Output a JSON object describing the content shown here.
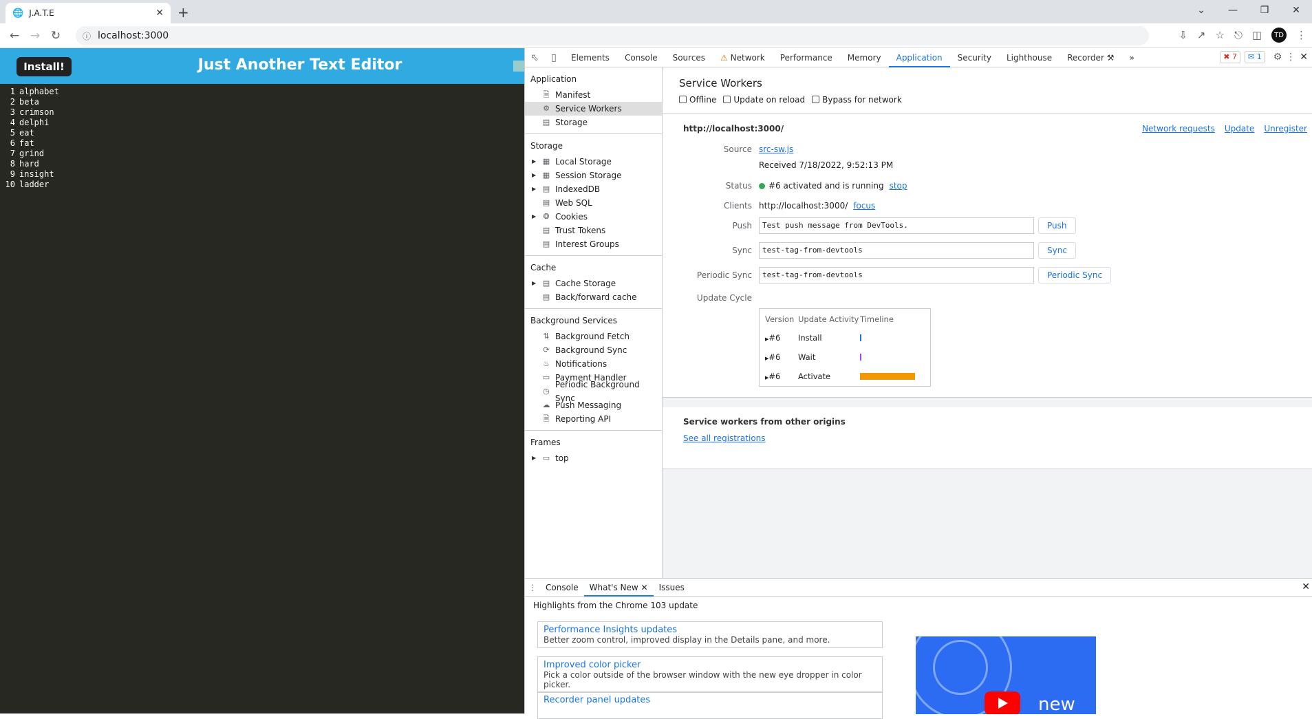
{
  "browser": {
    "tab_title": "J.A.T.E",
    "url": "localhost:3000",
    "avatar_initials": "TD"
  },
  "app": {
    "install_label": "Install!",
    "title": "Just Another Text Editor",
    "lines": [
      {
        "n": "1",
        "text": "alphabet"
      },
      {
        "n": "2",
        "text": "beta"
      },
      {
        "n": "3",
        "text": "crimson"
      },
      {
        "n": "4",
        "text": "delphi"
      },
      {
        "n": "5",
        "text": "eat"
      },
      {
        "n": "6",
        "text": "fat"
      },
      {
        "n": "7",
        "text": "grind"
      },
      {
        "n": "8",
        "text": "hard"
      },
      {
        "n": "9",
        "text": "insight"
      },
      {
        "n": "10",
        "text": "ladder"
      }
    ]
  },
  "devtools": {
    "tabs": [
      "Elements",
      "Console",
      "Sources",
      "Network",
      "Performance",
      "Memory",
      "Application",
      "Security",
      "Lighthouse",
      "Recorder"
    ],
    "active_tab": "Application",
    "error_count": "7",
    "message_count": "1",
    "sidebar": {
      "application": {
        "title": "Application",
        "items": [
          "Manifest",
          "Service Workers",
          "Storage"
        ]
      },
      "storage": {
        "title": "Storage",
        "items": [
          "Local Storage",
          "Session Storage",
          "IndexedDB",
          "Web SQL",
          "Cookies",
          "Trust Tokens",
          "Interest Groups"
        ]
      },
      "cache": {
        "title": "Cache",
        "items": [
          "Cache Storage",
          "Back/forward cache"
        ]
      },
      "background": {
        "title": "Background Services",
        "items": [
          "Background Fetch",
          "Background Sync",
          "Notifications",
          "Payment Handler",
          "Periodic Background Sync",
          "Push Messaging",
          "Reporting API"
        ]
      },
      "frames": {
        "title": "Frames",
        "items": [
          "top"
        ]
      }
    },
    "sw": {
      "title": "Service Workers",
      "opt_offline": "Offline",
      "opt_update": "Update on reload",
      "opt_bypass": "Bypass for network",
      "origin": "http://localhost:3000/",
      "link_network": "Network requests",
      "link_update": "Update",
      "link_unregister": "Unregister",
      "source_label": "Source",
      "source_file": "src-sw.js",
      "received": "Received 7/18/2022, 9:52:13 PM",
      "status_label": "Status",
      "status_text": "#6 activated and is running",
      "status_stop": "stop",
      "clients_label": "Clients",
      "clients_url": "http://localhost:3000/",
      "clients_focus": "focus",
      "push_label": "Push",
      "push_value": "Test push message from DevTools.",
      "push_btn": "Push",
      "sync_label": "Sync",
      "sync_value": "test-tag-from-devtools",
      "sync_btn": "Sync",
      "psync_label": "Periodic Sync",
      "psync_value": "test-tag-from-devtools",
      "psync_btn": "Periodic Sync",
      "cycle_label": "Update Cycle",
      "cycle_head": {
        "version": "Version",
        "activity": "Update Activity",
        "timeline": "Timeline"
      },
      "cycle_rows": [
        {
          "version": "#6",
          "activity": "Install"
        },
        {
          "version": "#6",
          "activity": "Wait"
        },
        {
          "version": "#6",
          "activity": "Activate"
        }
      ],
      "other_title": "Service workers from other origins",
      "other_link": "See all registrations"
    },
    "drawer": {
      "tabs": [
        "Console",
        "What's New",
        "Issues"
      ],
      "active": "What's New",
      "highlights": "Highlights from the Chrome 103 update",
      "cards": [
        {
          "title": "Performance Insights updates",
          "desc": "Better zoom control, improved display in the Details pane, and more."
        },
        {
          "title": "Improved color picker",
          "desc": "Pick a color outside of the browser window with the new eye dropper in color picker."
        },
        {
          "title": "Recorder panel updates",
          "desc": ""
        }
      ],
      "video_text": "new"
    }
  },
  "colors": {
    "app_header": "#31a9e1",
    "editor_bg": "#272822",
    "accent": "#1a73e8",
    "activate_bar": "#f29900"
  }
}
